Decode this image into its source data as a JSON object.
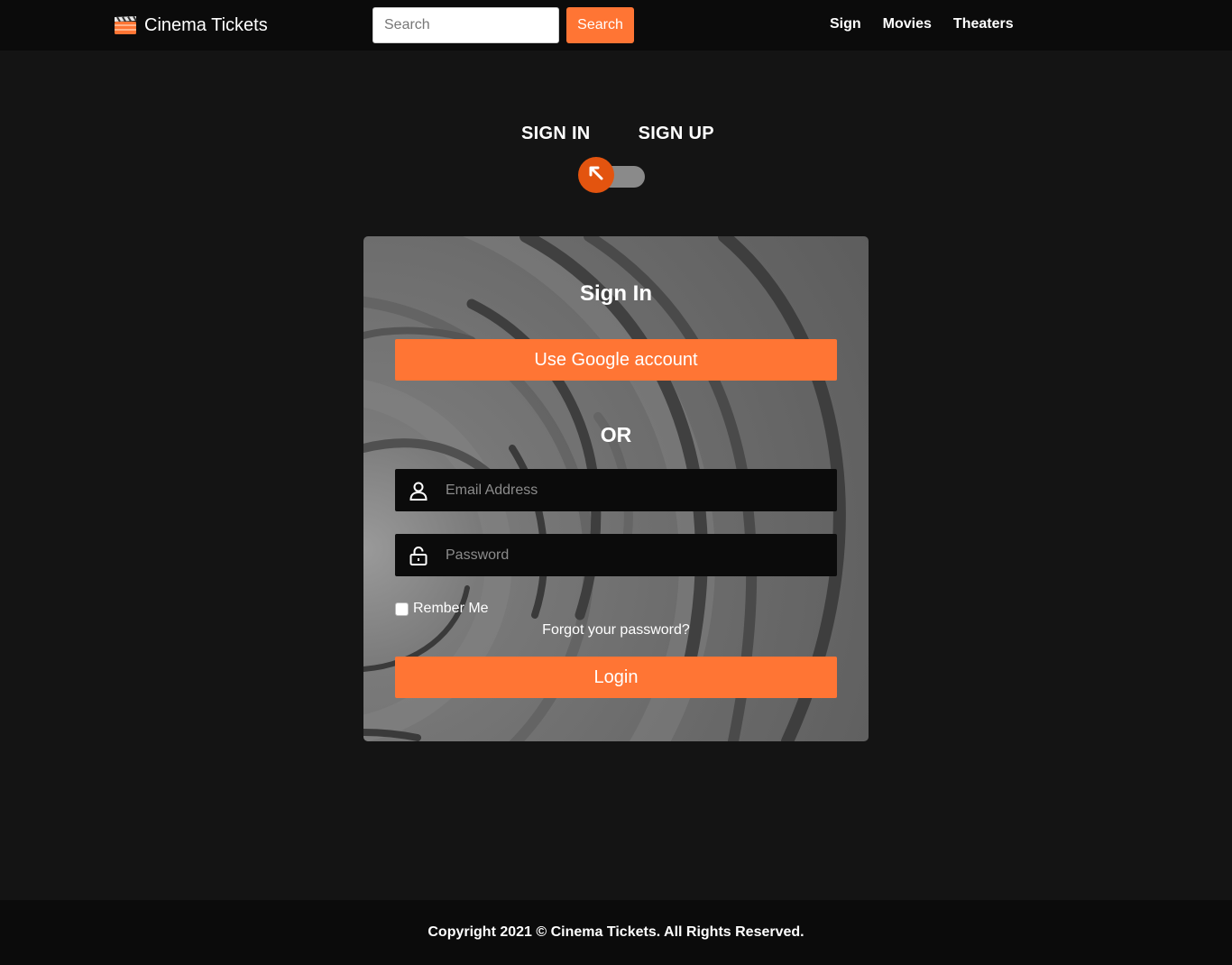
{
  "navbar": {
    "brand": "Cinema Tickets",
    "search_placeholder": "Search",
    "search_button": "Search",
    "links": [
      "Sign",
      "Movies",
      "Theaters"
    ]
  },
  "toggle": {
    "sign_in_label": "SIGN IN",
    "sign_up_label": "SIGN UP",
    "state": "sign-in"
  },
  "card": {
    "title": "Sign In",
    "google_button": "Use Google account",
    "or_label": "OR",
    "email_placeholder": "Email Address",
    "password_placeholder": "Password",
    "remember_label": "Rember Me",
    "remember_checked": false,
    "forgot_link": "Forgot your password?",
    "login_button": "Login"
  },
  "footer": {
    "copyright": "Copyright 2021 © Cinema Tickets. All Rights Reserved."
  },
  "colors": {
    "accent": "#ff7534",
    "toggle_knob": "#e3540f",
    "page_background": "#141414",
    "bar_background": "#0b0b0b"
  },
  "icons": [
    "clapperboard-icon",
    "arrow-up-left-icon",
    "user-icon",
    "unlock-icon"
  ]
}
